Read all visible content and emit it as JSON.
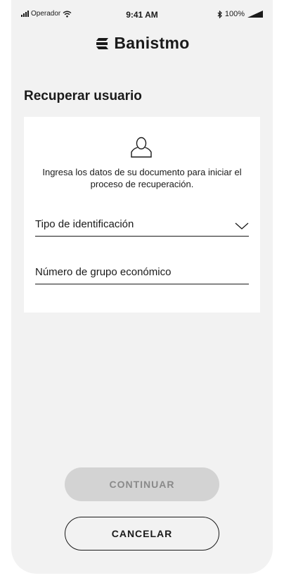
{
  "status_bar": {
    "carrier": "Operador",
    "time": "9:41 AM",
    "battery": "100%",
    "icons": [
      "signal-icon",
      "wifi-icon",
      "bluetooth-icon",
      "battery-icon"
    ]
  },
  "brand": {
    "name": "Banistmo",
    "logo_icon": "banistmo-logo-icon"
  },
  "page": {
    "title": "Recuperar usuario"
  },
  "form": {
    "icon": "user-icon",
    "instructions": "Ingresa los datos de su documento para iniciar el proceso de recuperación.",
    "id_type": {
      "label": "Tipo de identificación",
      "icon": "chevron-down-icon"
    },
    "group_number": {
      "label": "Número de grupo económico"
    }
  },
  "actions": {
    "continue_label": "CONTINUAR",
    "cancel_label": "CANCELAR"
  },
  "colors": {
    "background": "#f2f2f2",
    "card": "#ffffff",
    "text": "#1a1a1a",
    "disabled_button": "#d3d3d3",
    "disabled_text": "#8a8a8a"
  }
}
